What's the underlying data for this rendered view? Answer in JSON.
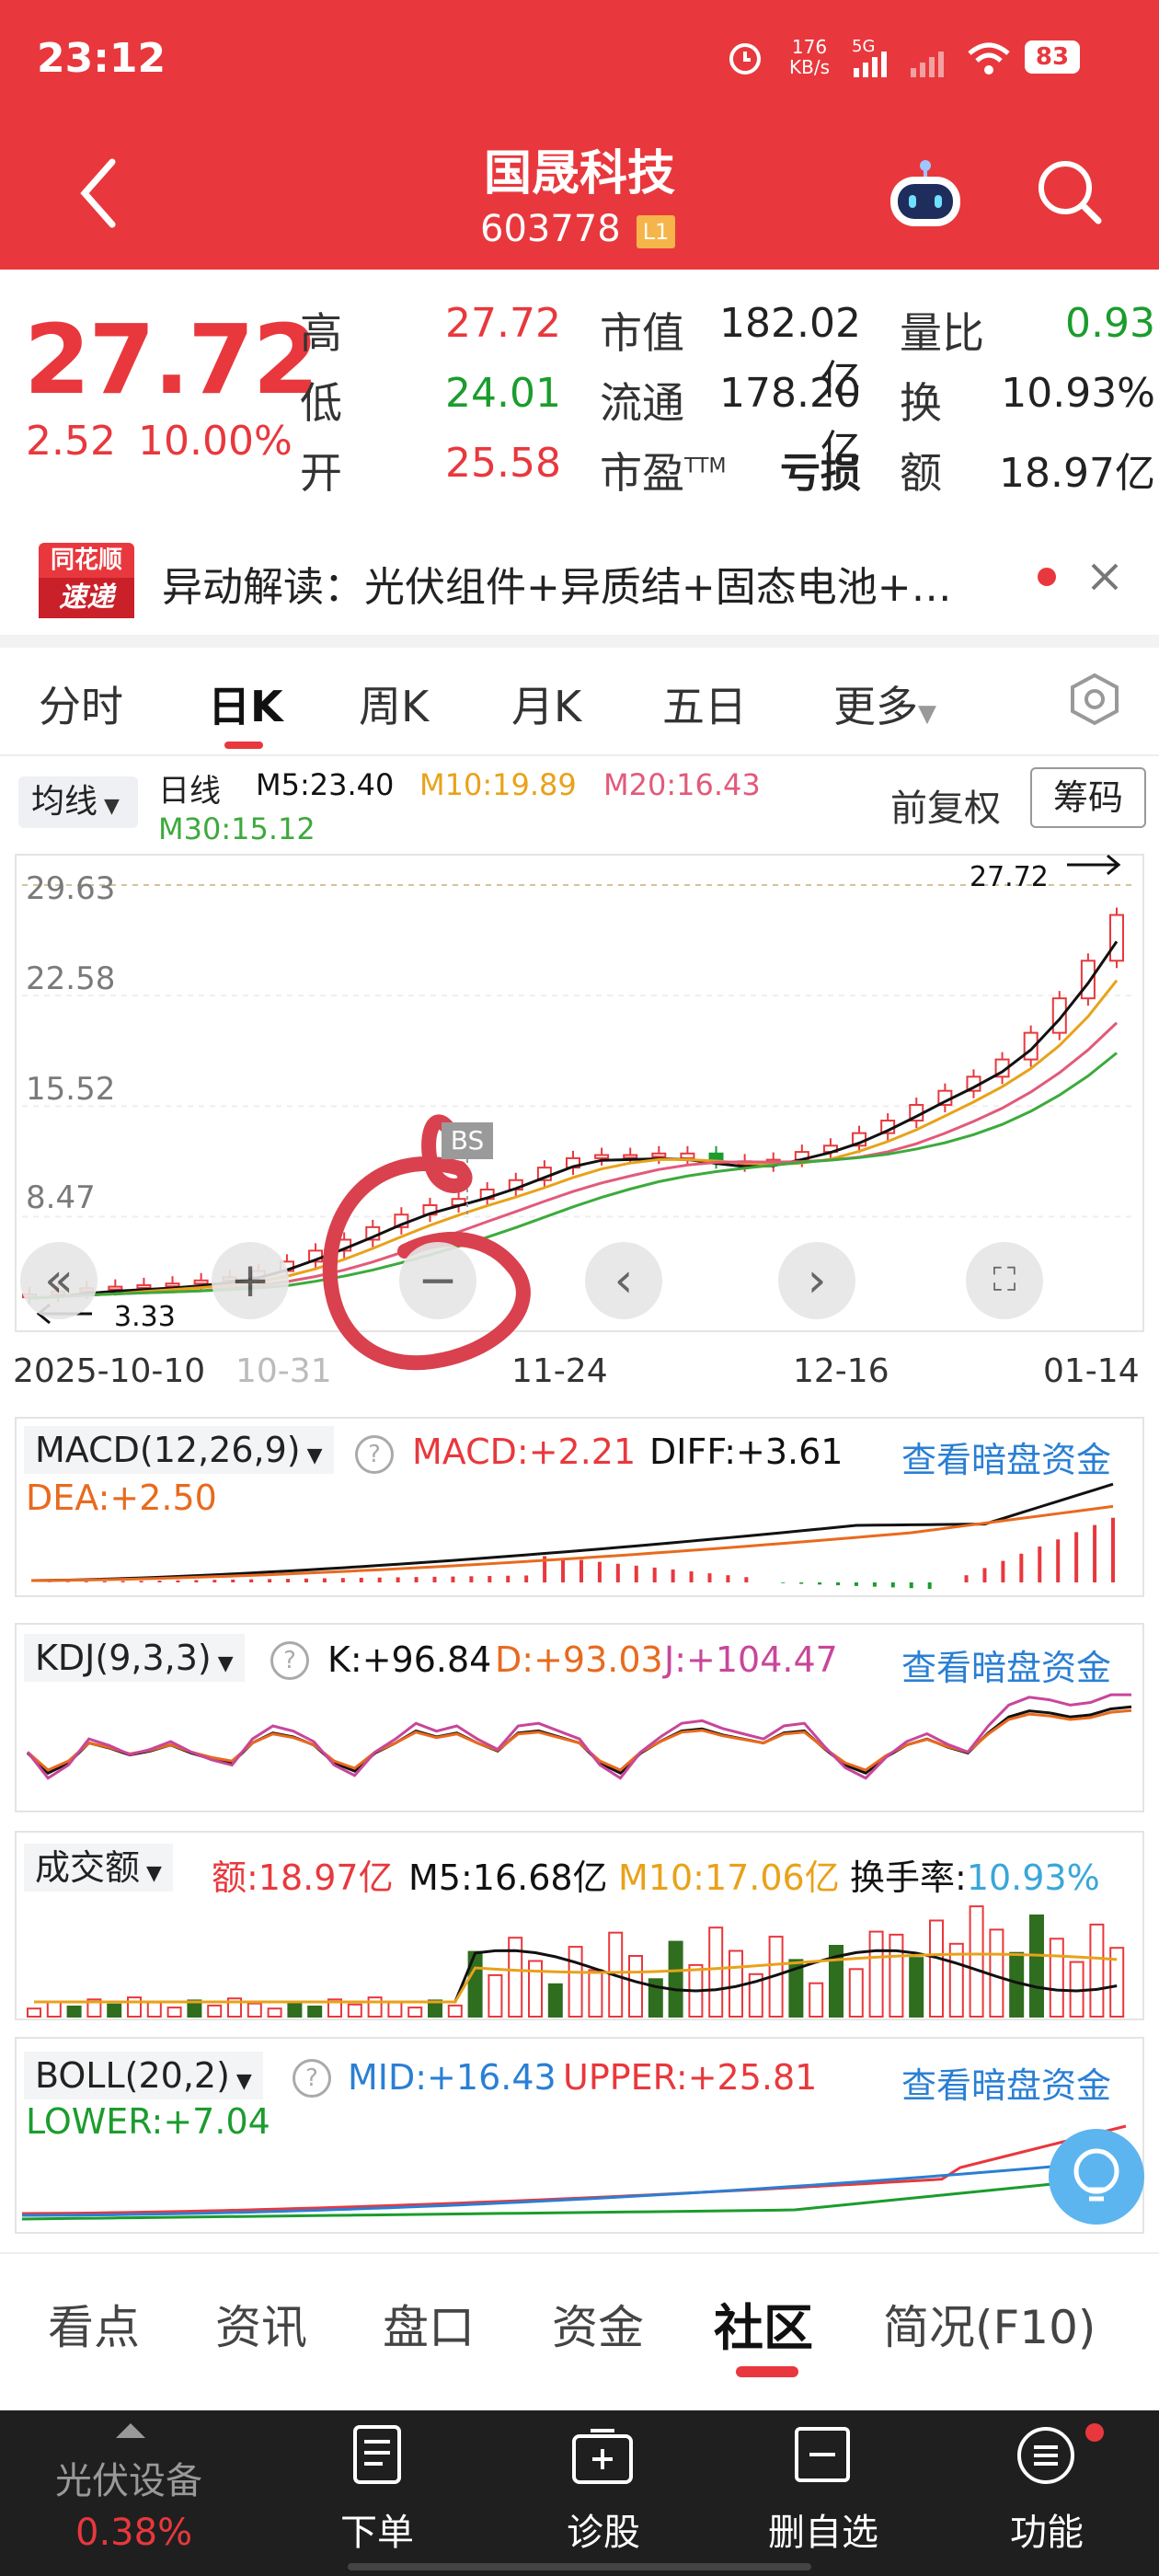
{
  "status_bar": {
    "time": "23:12",
    "net_speed": "176",
    "net_unit": "KB/s",
    "network": "5G",
    "battery": "83"
  },
  "header": {
    "title": "国晟科技",
    "code": "603778",
    "level_badge": "L1"
  },
  "quote": {
    "price": "27.72",
    "change": "2.52",
    "change_pct": "10.00%",
    "high_label": "高",
    "high": "27.72",
    "low_label": "低",
    "low": "24.01",
    "open_label": "开",
    "open": "25.58",
    "mktcap_label": "市值",
    "mktcap": "182.02亿",
    "float_label": "流通",
    "float": "178.20亿",
    "pe_label": "市盈",
    "pe_sup": "TTM",
    "pe": "亏损",
    "volratio_label": "量比",
    "volratio": "0.93",
    "turnover_label": "换",
    "turnover": "10.93%",
    "amount_label": "额",
    "amount": "18.97亿"
  },
  "news": {
    "logo_top": "同花顺",
    "logo_bottom": "速递",
    "text": "异动解读：光伏组件+异质结+固态电池+…"
  },
  "chart_tabs": [
    "分时",
    "日K",
    "周K",
    "月K",
    "五日",
    "更多"
  ],
  "active_tab": "日K",
  "kline": {
    "ma_select": "均线",
    "period": "日线",
    "m5": "M5:23.40",
    "m10": "M10:19.89",
    "m20": "M20:16.43",
    "m30": "M30:15.12",
    "adjust": "前复权",
    "chips": "筹码",
    "y_ticks": [
      "29.63",
      "22.58",
      "15.52",
      "8.47"
    ],
    "last_price": "27.72",
    "low_marker": "3.33",
    "bs_marker": "BS",
    "x_ticks": [
      "2025-10-10",
      "10-31",
      "11-24",
      "12-16",
      "01-14"
    ]
  },
  "macd": {
    "select": "MACD(12,26,9)",
    "macd": "MACD:+2.21",
    "diff": "DIFF:+3.61",
    "dea": "DEA:+2.50",
    "link": "查看暗盘资金"
  },
  "kdj": {
    "select": "KDJ(9,3,3)",
    "k": "K:+96.84",
    "d": "D:+93.03",
    "j": "J:+104.47",
    "link": "查看暗盘资金"
  },
  "amount_ind": {
    "select": "成交额",
    "amount": "额:18.97亿",
    "m5": "M5:16.68亿",
    "m10": "M10:17.06亿",
    "turnover_label": "换手率:",
    "turnover": "10.93%"
  },
  "boll": {
    "select": "BOLL(20,2)",
    "mid": "MID:+16.43",
    "upper": "UPPER:+25.81",
    "lower": "LOWER:+7.04",
    "link": "查看暗盘资金"
  },
  "bottom_tabs": [
    "看点",
    "资讯",
    "盘口",
    "资金",
    "社区",
    "简况(F10)"
  ],
  "active_bottom_tab": "社区",
  "bottom_bar": {
    "sector": "光伏设备",
    "sector_pct": "0.38%",
    "items": [
      "下单",
      "诊股",
      "删自选",
      "功能"
    ]
  },
  "colors": {
    "brand_red": "#e8383d",
    "up": "#e8383d",
    "down": "#1b9c2e",
    "ma5": "#111111",
    "ma10": "#e8a21a",
    "ma20": "#e25a7a",
    "ma30": "#3caa3c",
    "link": "#2a7fd4"
  },
  "chart_data": {
    "type": "candlestick",
    "title": "",
    "x_ticks": [
      "2025-10-10",
      "10-31",
      "11-24",
      "12-16",
      "01-14"
    ],
    "ylim": [
      3.33,
      29.63
    ],
    "y_ticks": [
      29.63,
      22.58,
      15.52,
      8.47
    ],
    "close_points": [
      3.5,
      3.7,
      3.9,
      4.0,
      4.1,
      4.2,
      4.4,
      4.6,
      5.0,
      5.6,
      6.3,
      7.0,
      7.8,
      8.6,
      9.2,
      9.6,
      10.2,
      10.8,
      11.6,
      12.2,
      12.4,
      12.3,
      12.5,
      12.2,
      12.0,
      11.8,
      12.1,
      12.6,
      13.0,
      13.8,
      14.6,
      15.6,
      16.5,
      17.4,
      18.5,
      20.2,
      22.4,
      24.8,
      27.72
    ],
    "last_price": 27.72,
    "low_marker": 3.33
  }
}
